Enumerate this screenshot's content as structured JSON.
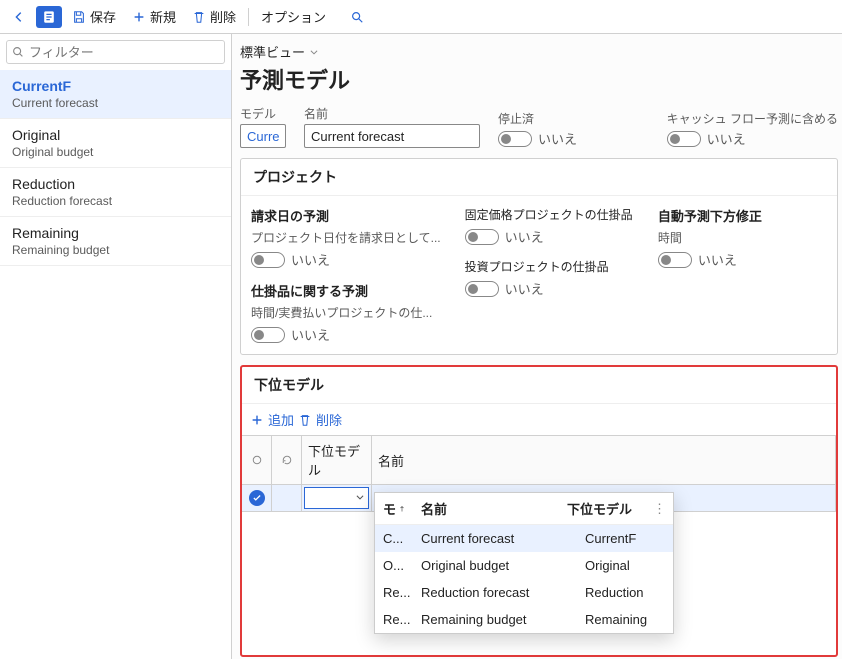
{
  "topbar": {
    "save": "保存",
    "new": "新規",
    "delete": "削除",
    "options": "オプション"
  },
  "sidebar": {
    "filter_placeholder": "フィルター",
    "items": [
      {
        "title": "CurrentF",
        "sub": "Current forecast",
        "selected": true
      },
      {
        "title": "Original",
        "sub": "Original budget",
        "selected": false
      },
      {
        "title": "Reduction",
        "sub": "Reduction forecast",
        "selected": false
      },
      {
        "title": "Remaining",
        "sub": "Remaining budget",
        "selected": false
      }
    ]
  },
  "header": {
    "view_label": "標準ビュー",
    "page_title": "予測モデル",
    "model_label": "モデル",
    "model_value": "Curre",
    "name_label": "名前",
    "name_value": "Current forecast",
    "stopped_label": "停止済",
    "stopped_value": "いいえ",
    "cashflow_label": "キャッシュ フロー予測に含める",
    "cashflow_value": "いいえ"
  },
  "project": {
    "title": "プロジェクト",
    "invoice_group": "請求日の予測",
    "invoice_sub": "プロジェクト日付を請求日として...",
    "invoice_val": "いいえ",
    "wip_group": "仕掛品に関する予測",
    "wip_sub": "時間/実費払いプロジェクトの仕...",
    "wip_val": "いいえ",
    "fixed_label": "固定価格プロジェクトの仕掛品",
    "fixed_val": "いいえ",
    "invest_label": "投資プロジェクトの仕掛品",
    "invest_val": "いいえ",
    "auto_group": "自動予測下方修正",
    "auto_sub": "時間",
    "auto_val": "いいえ"
  },
  "submodel": {
    "title": "下位モデル",
    "add": "追加",
    "delete": "削除",
    "col_model": "下位モデル",
    "col_name": "名前",
    "popup": {
      "col_mo": "モ",
      "col_name": "名前",
      "col_sub": "下位モデル",
      "rows": [
        {
          "mo": "C...",
          "name": "Current forecast",
          "sub": "CurrentF",
          "selected": true
        },
        {
          "mo": "O...",
          "name": "Original budget",
          "sub": "Original",
          "selected": false
        },
        {
          "mo": "Re...",
          "name": "Reduction forecast",
          "sub": "Reduction",
          "selected": false
        },
        {
          "mo": "Re...",
          "name": "Remaining budget",
          "sub": "Remaining",
          "selected": false
        }
      ]
    }
  }
}
